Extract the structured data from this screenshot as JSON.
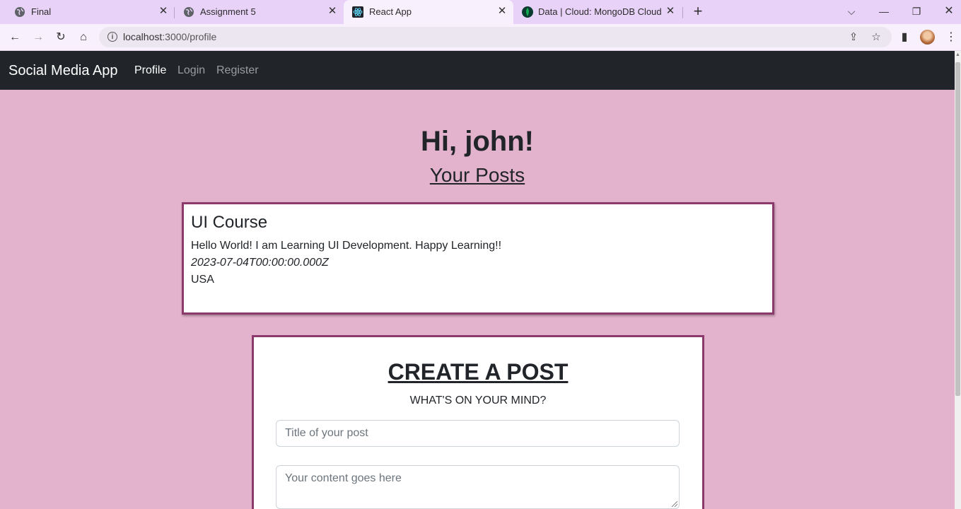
{
  "browser": {
    "tabs": [
      {
        "title": "Final",
        "icon": "globe-icon"
      },
      {
        "title": "Assignment 5",
        "icon": "globe-icon"
      },
      {
        "title": "React App",
        "icon": "react-icon"
      },
      {
        "title": "Data | Cloud: MongoDB Cloud",
        "icon": "mongodb-leaf-icon"
      }
    ],
    "url_host": "localhost",
    "url_path": ":3000/profile"
  },
  "navbar": {
    "brand": "Social Media App",
    "links": [
      "Profile",
      "Login",
      "Register"
    ]
  },
  "profile": {
    "greeting": "Hi, john!",
    "posts_heading": "Your Posts"
  },
  "posts": [
    {
      "title": "UI Course",
      "content": "Hello World! I am Learning UI Development. Happy Learning!!",
      "date": "2023-07-04T00:00:00.000Z",
      "location": "USA"
    }
  ],
  "create_post": {
    "heading": "CREATE A POST",
    "subheading": "WHAT'S ON YOUR MIND?",
    "title_placeholder": "Title of your post",
    "content_placeholder": "Your content goes here"
  }
}
